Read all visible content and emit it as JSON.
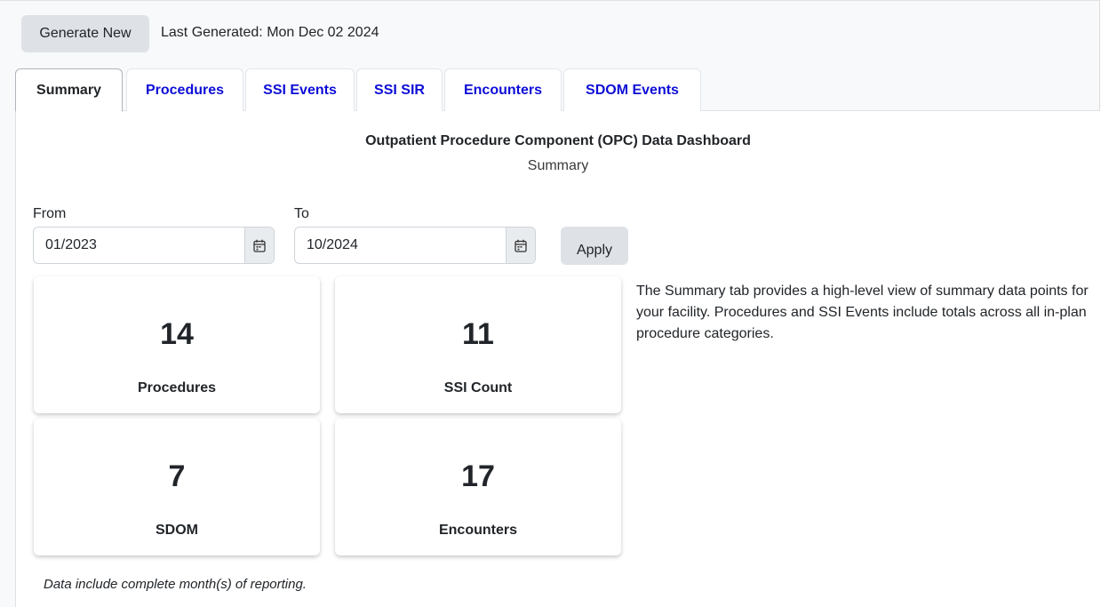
{
  "header": {
    "generate_label": "Generate New",
    "last_generated": "Last Generated: Mon Dec 02 2024"
  },
  "tabs": [
    {
      "label": "Summary",
      "active": true
    },
    {
      "label": "Procedures",
      "active": false
    },
    {
      "label": "SSI Events",
      "active": false
    },
    {
      "label": "SSI SIR",
      "active": false
    },
    {
      "label": "Encounters",
      "active": false
    },
    {
      "label": "SDOM Events",
      "active": false
    }
  ],
  "dashboard": {
    "title": "Outpatient Procedure Component (OPC) Data Dashboard",
    "subtitle": "Summary"
  },
  "filters": {
    "from_label": "From",
    "from_value": "01/2023",
    "to_label": "To",
    "to_value": "10/2024",
    "apply_label": "Apply",
    "calendar_icon": "calendar-icon"
  },
  "cards": [
    {
      "value": "14",
      "label": "Procedures"
    },
    {
      "value": "11",
      "label": "SSI Count"
    },
    {
      "value": "7",
      "label": "SDOM"
    },
    {
      "value": "17",
      "label": "Encounters"
    }
  ],
  "description": "The Summary tab provides a high-level view of summary data points for your facility. Procedures and SSI Events include totals across all in-plan procedure categories.",
  "note": "Data include complete month(s) of reporting.",
  "colors": {
    "tab_link": "#0d0dd6",
    "button_bg": "#dee2e6"
  }
}
